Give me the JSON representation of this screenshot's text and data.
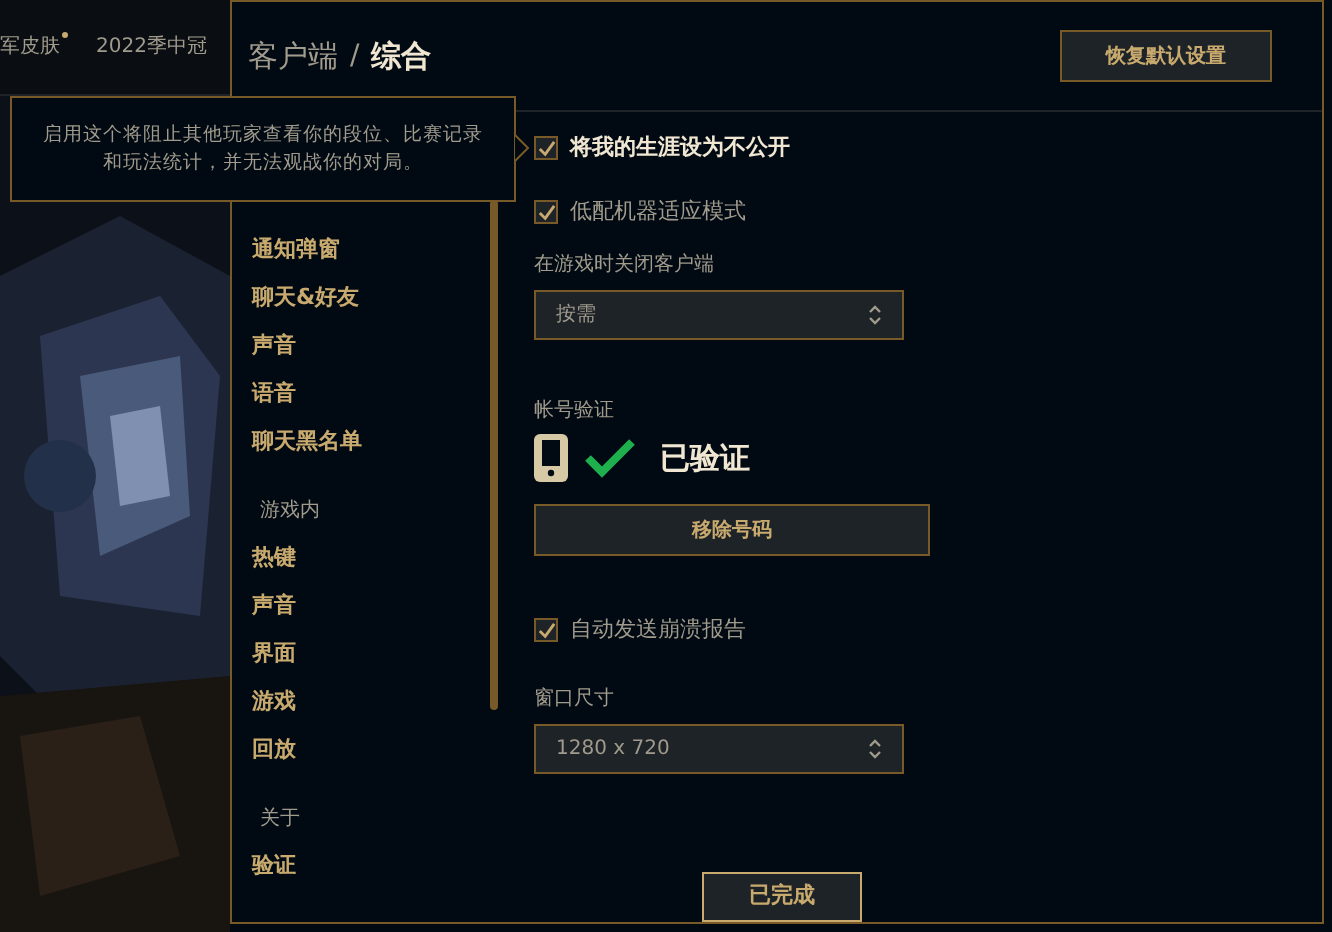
{
  "background": {
    "tabs": [
      "军皮肤",
      "2022季中冠"
    ],
    "new_dot": true
  },
  "tooltip": {
    "text": "启用这个将阻止其他玩家查看你的段位、比赛记录和玩法统计，并无法观战你的对局。"
  },
  "dialog": {
    "breadcrumb": "客户端",
    "separator": "/",
    "title": "综合",
    "reset_button": "恢复默认设置",
    "done_button": "已完成"
  },
  "sidebar": {
    "sections": [
      {
        "items": [
          {
            "label": "通知弹窗",
            "selected": false
          },
          {
            "label": "聊天&好友",
            "selected": false
          },
          {
            "label": "声音",
            "selected": false
          },
          {
            "label": "语音",
            "selected": false
          },
          {
            "label": "聊天黑名单",
            "selected": false
          }
        ]
      },
      {
        "title": "游戏内",
        "items": [
          {
            "label": "热键",
            "selected": false
          },
          {
            "label": "声音",
            "selected": false
          },
          {
            "label": "界面",
            "selected": false
          },
          {
            "label": "游戏",
            "selected": false
          },
          {
            "label": "回放",
            "selected": false
          }
        ]
      },
      {
        "title": "关于",
        "items": [
          {
            "label": "验证",
            "selected": false
          }
        ]
      }
    ]
  },
  "content": [
    {
      "kind": "checkbox",
      "label": "将我的生涯设为不公开",
      "checked": true,
      "bold": true
    },
    {
      "kind": "checkbox",
      "label": "低配机器适应模式",
      "checked": true,
      "bold": false
    },
    {
      "kind": "select",
      "label": "在游戏时关闭客户端",
      "value": "按需"
    },
    {
      "kind": "verify",
      "label": "帐号验证",
      "status": "已验证",
      "verified": true,
      "button": "移除号码"
    },
    {
      "kind": "checkbox",
      "label": "自动发送崩溃报告",
      "checked": true,
      "bold": false
    },
    {
      "kind": "select",
      "label": "窗口尺寸",
      "value": "1280 x 720"
    }
  ]
}
